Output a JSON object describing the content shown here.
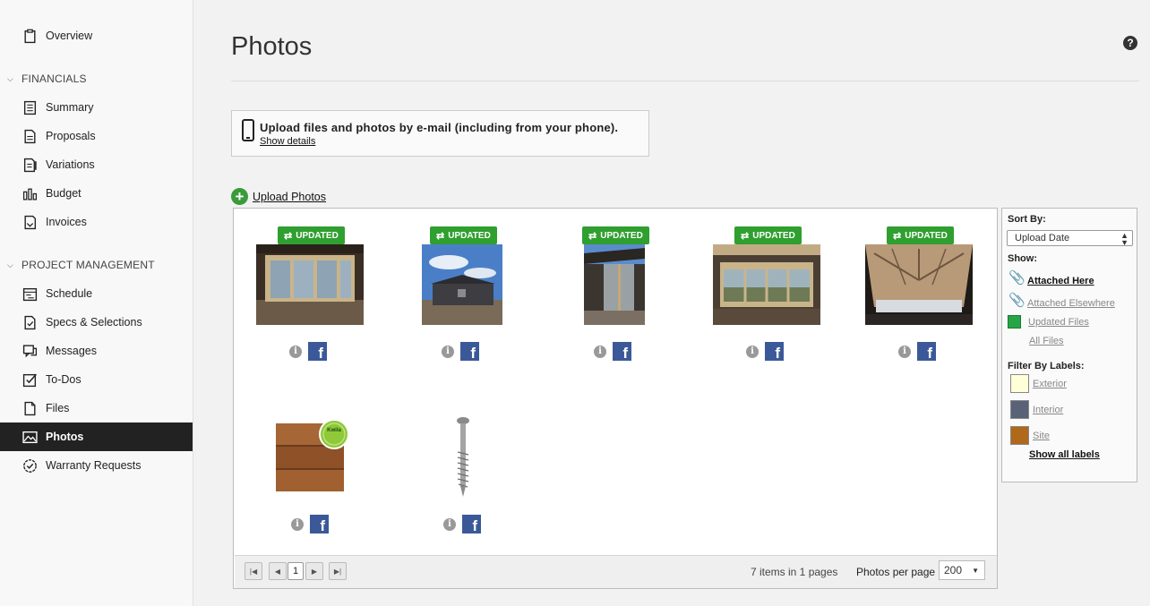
{
  "sidebar": {
    "overview": "Overview",
    "sections": [
      {
        "label": "FINANCIALS"
      },
      {
        "label": "PROJECT MANAGEMENT"
      }
    ],
    "financials": [
      "Summary",
      "Proposals",
      "Variations",
      "Budget",
      "Invoices"
    ],
    "project": [
      "Schedule",
      "Specs & Selections",
      "Messages",
      "To-Dos",
      "Files",
      "Photos",
      "Warranty Requests"
    ],
    "active": "Photos"
  },
  "page": {
    "title": "Photos",
    "help": "?"
  },
  "email_box": {
    "message": "Upload files and photos by e-mail (including from your phone).",
    "details_link": "Show details"
  },
  "upload": {
    "label": "Upload Photos"
  },
  "photos": [
    {
      "badge": "UPDATED",
      "info": "i",
      "fb": "f"
    },
    {
      "badge": "UPDATED",
      "info": "i",
      "fb": "f"
    },
    {
      "badge": "UPDATED",
      "info": "i",
      "fb": "f"
    },
    {
      "badge": "UPDATED",
      "info": "i",
      "fb": "f"
    },
    {
      "badge": "UPDATED",
      "info": "i",
      "fb": "f"
    },
    {
      "badge": "",
      "info": "i",
      "fb": "f",
      "logo": "Kwila"
    },
    {
      "badge": "",
      "info": "i",
      "fb": "f"
    }
  ],
  "pager": {
    "current_page": "1",
    "count": "7 items in 1 pages",
    "per_page_label": "Photos per page",
    "per_page_value": "200"
  },
  "filter": {
    "sort_by_label": "Sort By:",
    "sort_value": "Upload Date",
    "show_label": "Show:",
    "attached_here": "Attached Here",
    "attached_elsewhere": "Attached Elsewhere",
    "updated_files": "Updated Files",
    "all_files": "All Files",
    "filter_labels_title": "Filter By Labels:",
    "labels": [
      {
        "name": "Exterior",
        "color": "#ffffd8"
      },
      {
        "name": "Interior",
        "color": "#5a6278"
      },
      {
        "name": "Site",
        "color": "#b0681a"
      }
    ],
    "show_all_labels": "Show all labels"
  },
  "colors": {
    "accent_green": "#2f9f2f",
    "facebook": "#3b5998",
    "active_nav": "#222222"
  }
}
